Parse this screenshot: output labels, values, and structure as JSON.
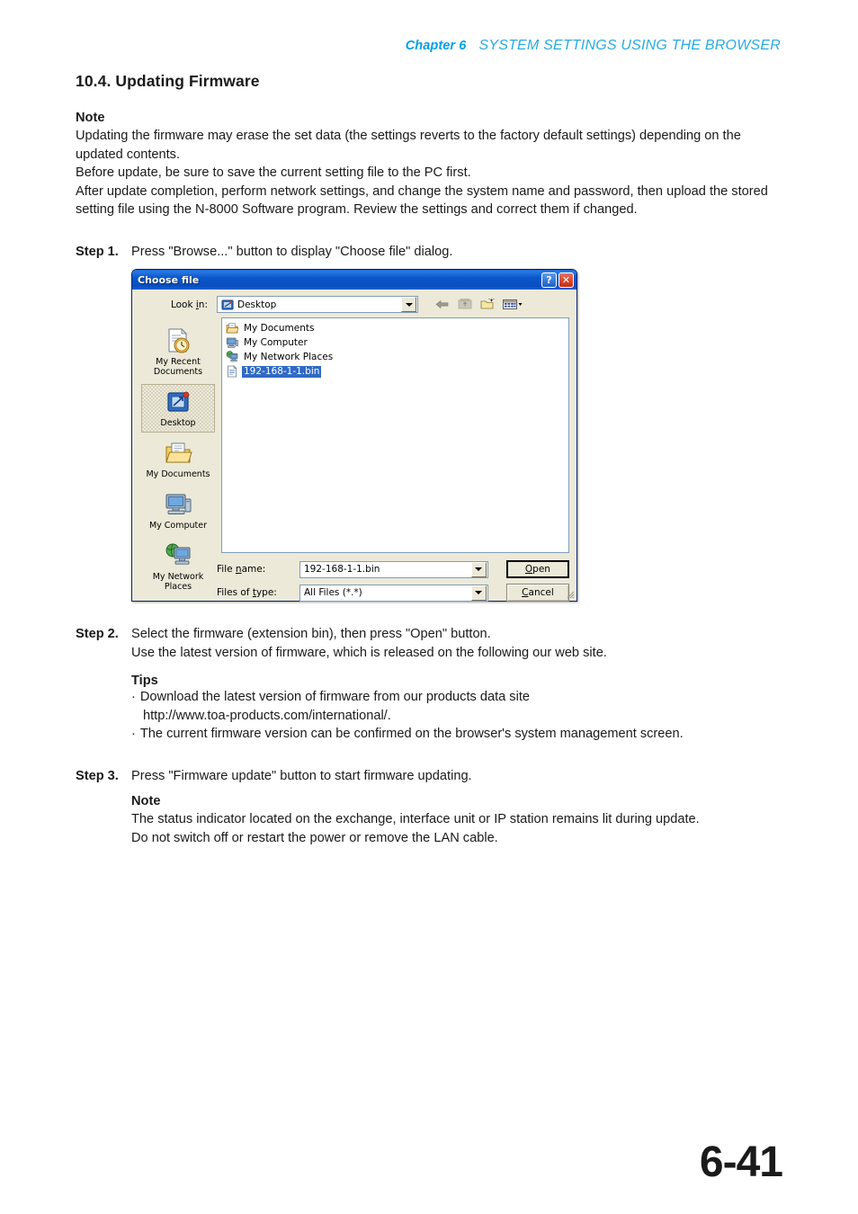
{
  "header": {
    "chapter": "Chapter 6",
    "title": "SYSTEM SETTINGS USING THE BROWSER"
  },
  "section": {
    "title": "10.4. Updating Firmware"
  },
  "note_top": {
    "heading": "Note",
    "line1": "Updating the firmware may erase the set data (the settings reverts to the factory default settings) depending on the updated contents.",
    "line2": "Before update, be sure to save the current setting file to the PC first.",
    "line3": "After update completion, perform network settings, and change the system name and password, then upload the stored setting file using the N-8000 Software program. Review the settings and correct them if changed."
  },
  "step1": {
    "label": "Step 1.",
    "text": "Press \"Browse...\" button to display \"Choose file\" dialog."
  },
  "step2": {
    "label": "Step 2.",
    "text": "Select the firmware (extension bin), then press \"Open\" button.",
    "text2": "Use the latest version of firmware, which is released on the following our web site.",
    "tips_heading": "Tips",
    "bullet_marker": "·",
    "bullet1": "Download the latest version of firmware from our products data site",
    "bullet1_cont": "http://www.toa-products.com/international/.",
    "bullet2": "The current firmware version can be confirmed on the browser's system management screen."
  },
  "step3": {
    "label": "Step 3.",
    "text": "Press \"Firmware update\" button to start firmware updating.",
    "note_heading": "Note",
    "note_line1": "The status indicator located on the exchange, interface unit or IP station remains lit during update.",
    "note_line2": "Do not switch off or restart the power or remove the LAN cable."
  },
  "dialog": {
    "title": "Choose file",
    "help_button": "?",
    "close_button": "✕",
    "lookin_label_pre": "Look ",
    "lookin_label_mnemonic": "i",
    "lookin_label_post": "n:",
    "lookin_value": "Desktop",
    "toolbar_icons": [
      "back-arrow-icon",
      "up-folder-icon",
      "new-folder-icon",
      "views-icon"
    ],
    "places": [
      {
        "label": "My Recent\nDocuments",
        "icon": "recent-documents-icon",
        "selected": false
      },
      {
        "label": "Desktop",
        "icon": "desktop-icon",
        "selected": true
      },
      {
        "label": "My Documents",
        "icon": "my-documents-icon",
        "selected": false
      },
      {
        "label": "My Computer",
        "icon": "my-computer-icon",
        "selected": false
      },
      {
        "label": "My Network\nPlaces",
        "icon": "my-network-places-icon",
        "selected": false
      }
    ],
    "files": [
      {
        "name": "My Documents",
        "icon": "folder-documents-icon",
        "selected": false
      },
      {
        "name": "My Computer",
        "icon": "computer-icon",
        "selected": false
      },
      {
        "name": "My Network Places",
        "icon": "network-icon",
        "selected": false
      },
      {
        "name": "192-168-1-1.bin",
        "icon": "bin-file-icon",
        "selected": true
      }
    ],
    "filename_label_pre": "File ",
    "filename_label_mnemonic": "n",
    "filename_label_post": "ame:",
    "filename_value": "192-168-1-1.bin",
    "filetype_label_pre": "Files of ",
    "filetype_label_mnemonic": "t",
    "filetype_label_post": "ype:",
    "filetype_value": "All Files (*.*)",
    "open_button_mnemonic": "O",
    "open_button_rest": "pen",
    "cancel_button_mnemonic": "C",
    "cancel_button_rest": "ancel",
    "colors": {
      "titlebar": "#0a55c8",
      "face": "#ece9d8",
      "selection": "#316ac5",
      "field_border": "#7f9db9"
    }
  },
  "footer": {
    "page_number": "6-41"
  }
}
